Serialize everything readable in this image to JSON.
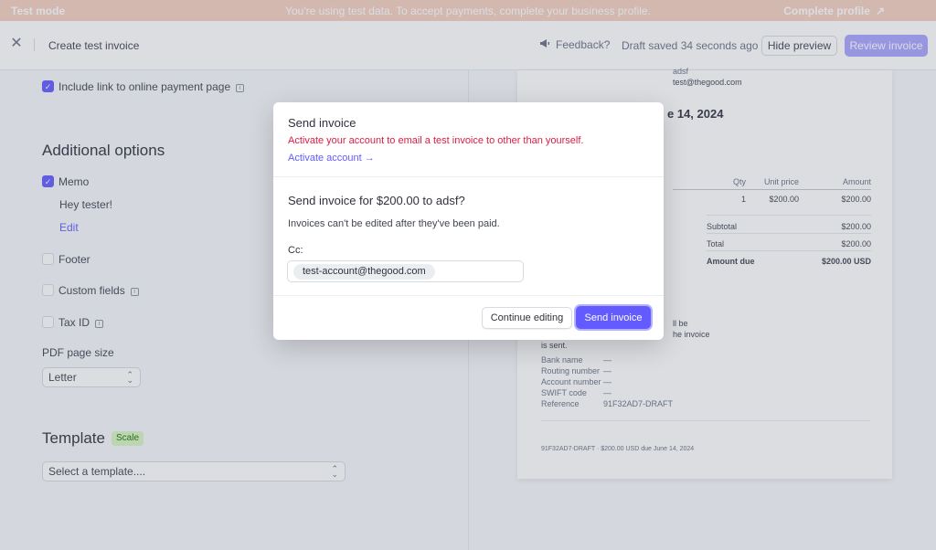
{
  "banner": {
    "mode": "Test mode",
    "message": "You're using test data. To accept payments, complete your business profile.",
    "cta": "Complete profile"
  },
  "header": {
    "title": "Create test invoice",
    "feedback": "Feedback?",
    "saved": "Draft saved 34 seconds ago",
    "hide_preview": "Hide preview",
    "review_invoice": "Review invoice"
  },
  "form": {
    "include_link": "Include link to online payment page",
    "additional_options": "Additional options",
    "memo": "Memo",
    "memo_text": "Hey tester!",
    "memo_edit": "Edit",
    "footer": "Footer",
    "custom_fields": "Custom fields",
    "tax_id": "Tax ID",
    "pdf_page_size": "PDF page size",
    "pdf_page_size_value": "Letter",
    "template": "Template",
    "template_badge": "Scale",
    "template_placeholder": "Select a template...."
  },
  "preview": {
    "name_partial": "adsf",
    "email": "test@thegood.com",
    "date_partial": "e 14, 2024",
    "col_qty": "Qty",
    "col_unit": "Unit price",
    "col_amount": "Amount",
    "row_qty": "1",
    "row_unit": "$200.00",
    "row_amount": "$200.00",
    "subtotal_label": "Subtotal",
    "subtotal": "$200.00",
    "total_label": "Total",
    "total": "$200.00",
    "amount_due_label": "Amount due",
    "amount_due": "$200.00 USD",
    "frag1": "ll be",
    "frag2": "he invoice",
    "frag3": "is sent.",
    "bank_name_label": "Bank name",
    "bank_name": "—",
    "routing_label": "Routing number",
    "routing": "—",
    "account_label": "Account number",
    "account": "—",
    "swift_label": "SWIFT code",
    "swift": "—",
    "reference_label": "Reference",
    "reference": "91F32AD7-DRAFT",
    "footer_line": "91F32AD7-DRAFT · $200.00 USD due June 14, 2024"
  },
  "modal": {
    "title": "Send invoice",
    "error": "Activate your account to email a test invoice to other than yourself.",
    "activate_link": "Activate account →",
    "question": "Send invoice for $200.00 to adsf?",
    "note": "Invoices can't be edited after they've been paid.",
    "cc_label": "Cc:",
    "cc_email": "test-account@thegood.com",
    "continue_editing": "Continue editing",
    "send_invoice": "Send invoice"
  },
  "colors": {
    "accent": "#635bff",
    "error": "#df1b41",
    "banner": "#f5d0c0"
  }
}
